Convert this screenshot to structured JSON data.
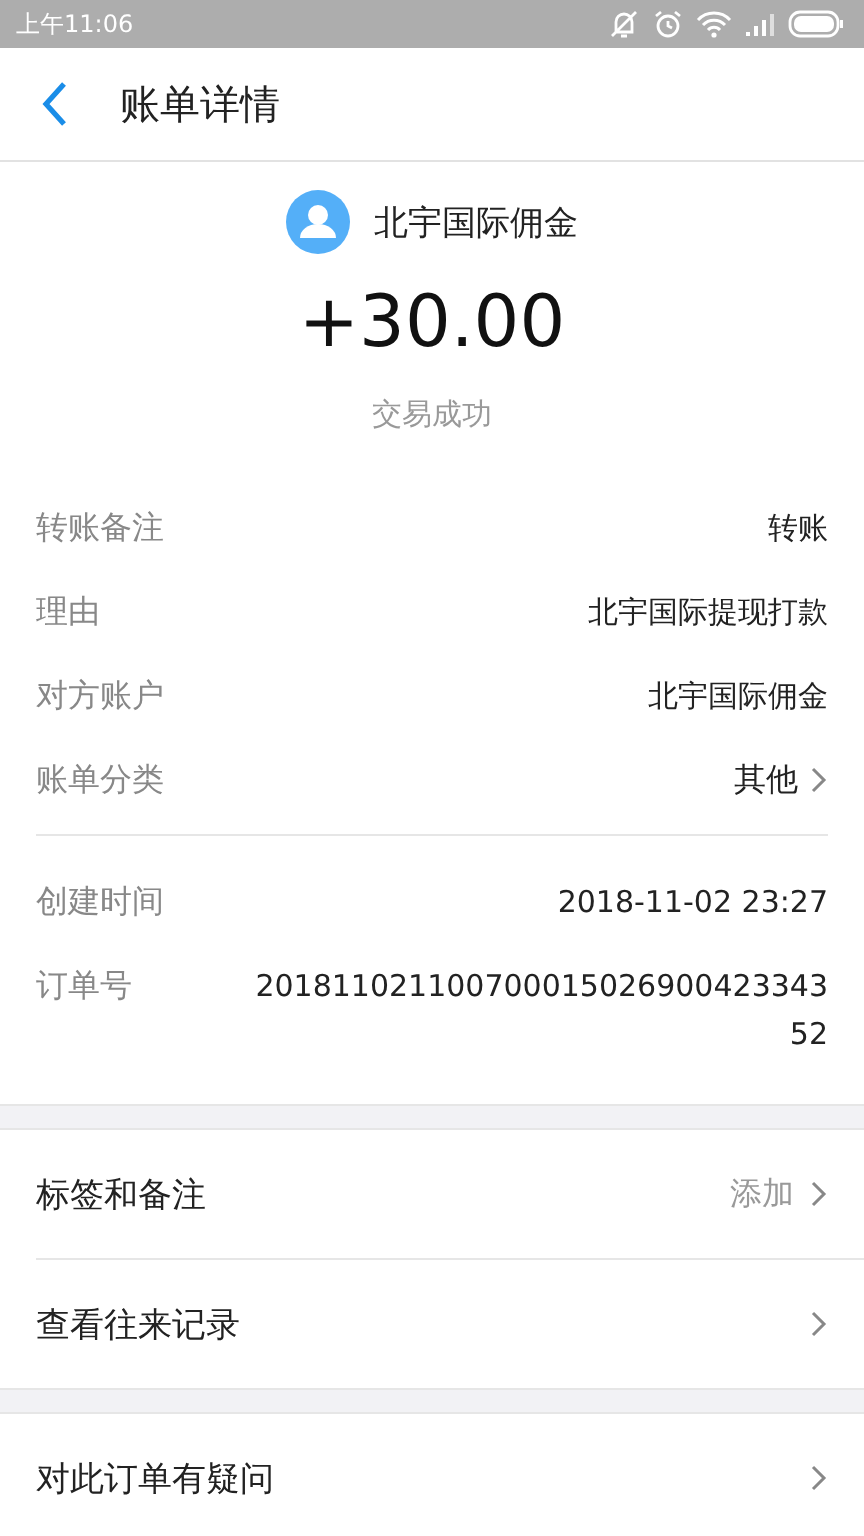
{
  "status_bar": {
    "time": "上午11:06"
  },
  "header": {
    "title": "账单详情"
  },
  "summary": {
    "name": "北宇国际佣金",
    "amount": "+30.00",
    "status": "交易成功"
  },
  "detail_groups": [
    {
      "rows": [
        {
          "label": "转账备注",
          "value": "转账",
          "kind": "plain"
        },
        {
          "label": "理由",
          "value": "北宇国际提现打款",
          "kind": "plain"
        },
        {
          "label": "对方账户",
          "value": "北宇国际佣金",
          "kind": "plain"
        },
        {
          "label": "账单分类",
          "value": "其他",
          "kind": "link"
        }
      ]
    },
    {
      "rows": [
        {
          "label": "创建时间",
          "value": "2018-11-02 23:27",
          "kind": "plain"
        },
        {
          "label": "订单号",
          "value": "20181102110070001502690042334352",
          "kind": "plain"
        }
      ]
    }
  ],
  "menu_groups": [
    {
      "rows": [
        {
          "label": "标签和备注",
          "value": "添加"
        },
        {
          "label": "查看往来记录"
        }
      ]
    },
    {
      "rows": [
        {
          "label": "对此订单有疑问"
        }
      ]
    }
  ]
}
